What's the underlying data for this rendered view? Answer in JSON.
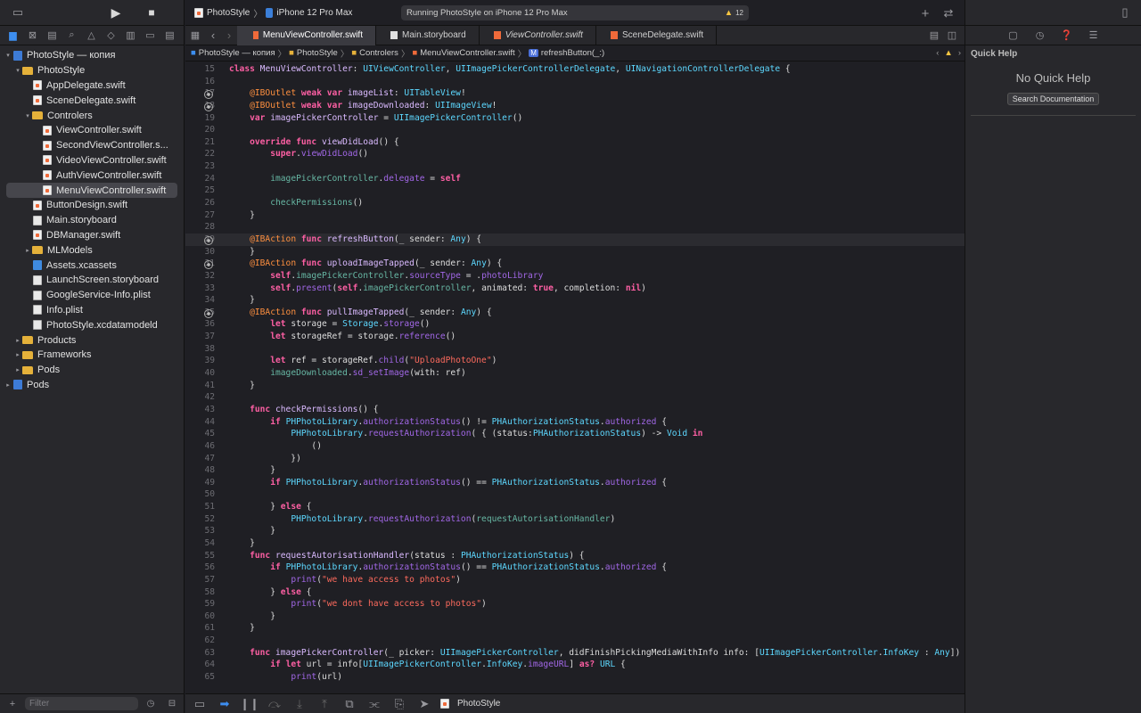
{
  "toolbar": {
    "scheme": "PhotoStyle",
    "device": "iPhone 12 Pro Max",
    "status": "Running PhotoStyle on iPhone 12 Pro Max",
    "warnings": "12"
  },
  "navigator": {
    "filter_placeholder": "Filter",
    "rows": [
      {
        "label": "PhotoStyle — копия",
        "indent": 0,
        "disc": "▾",
        "icon": "proj"
      },
      {
        "label": "PhotoStyle",
        "indent": 1,
        "disc": "▾",
        "icon": "fold"
      },
      {
        "label": "AppDelegate.swift",
        "indent": 2,
        "disc": "",
        "icon": "swift"
      },
      {
        "label": "SceneDelegate.swift",
        "indent": 2,
        "disc": "",
        "icon": "swift"
      },
      {
        "label": "Controlers",
        "indent": 2,
        "disc": "▾",
        "icon": "fold"
      },
      {
        "label": "ViewController.swift",
        "indent": 3,
        "disc": "",
        "icon": "swift"
      },
      {
        "label": "SecondViewController.s...",
        "indent": 3,
        "disc": "",
        "icon": "swift"
      },
      {
        "label": "VideoViewController.swift",
        "indent": 3,
        "disc": "",
        "icon": "swift"
      },
      {
        "label": "AuthViewController.swift",
        "indent": 3,
        "disc": "",
        "icon": "swift"
      },
      {
        "label": "MenuViewController.swift",
        "indent": 3,
        "disc": "",
        "icon": "swift",
        "selected": true
      },
      {
        "label": "ButtonDesign.swift",
        "indent": 2,
        "disc": "",
        "icon": "swift"
      },
      {
        "label": "Main.storyboard",
        "indent": 2,
        "disc": "",
        "icon": "sb"
      },
      {
        "label": "DBManager.swift",
        "indent": 2,
        "disc": "",
        "icon": "swift"
      },
      {
        "label": "MLModels",
        "indent": 2,
        "disc": "▸",
        "icon": "fold"
      },
      {
        "label": "Assets.xcassets",
        "indent": 2,
        "disc": "",
        "icon": "assets"
      },
      {
        "label": "LaunchScreen.storyboard",
        "indent": 2,
        "disc": "",
        "icon": "sb"
      },
      {
        "label": "GoogleService-Info.plist",
        "indent": 2,
        "disc": "",
        "icon": "plist"
      },
      {
        "label": "Info.plist",
        "indent": 2,
        "disc": "",
        "icon": "plist"
      },
      {
        "label": "PhotoStyle.xcdatamodeld",
        "indent": 2,
        "disc": "",
        "icon": "data"
      },
      {
        "label": "Products",
        "indent": 1,
        "disc": "▸",
        "icon": "fold"
      },
      {
        "label": "Frameworks",
        "indent": 1,
        "disc": "▸",
        "icon": "fold"
      },
      {
        "label": "Pods",
        "indent": 1,
        "disc": "▸",
        "icon": "fold"
      },
      {
        "label": "Pods",
        "indent": 0,
        "disc": "▸",
        "icon": "proj"
      }
    ]
  },
  "tabs": [
    {
      "label": "MenuViewController.swift",
      "active": true
    },
    {
      "label": "Main.storyboard",
      "active": false
    },
    {
      "label": "ViewController.swift",
      "active": false
    },
    {
      "label": "SceneDelegate.swift",
      "active": false
    }
  ],
  "jumpbar": {
    "p1": "PhotoStyle — копия",
    "p2": "PhotoStyle",
    "p3": "Controlers",
    "p4": "MenuViewController.swift",
    "p5": "refreshButton(_:)"
  },
  "inspector": {
    "title": "Quick Help",
    "empty": "No Quick Help",
    "search_button": "Search Documentation"
  },
  "bottombar": {
    "scheme": "PhotoStyle"
  },
  "code": [
    {
      "n": 15,
      "t": "<k>class</k> <y>MenuViewController</y>: <t>UIViewController</t>, <t>UIImagePickerControllerDelegate</t>, <t>UINavigationControllerDelegate</t> {"
    },
    {
      "n": 16,
      "t": ""
    },
    {
      "n": 17,
      "bp": true,
      "t": "    <a>@IBOutlet</a> <k>weak</k> <k>var</k> <y>imageList</y>: <t>UITableView</t>!"
    },
    {
      "n": 18,
      "bp": true,
      "t": "    <a>@IBOutlet</a> <k>weak</k> <k>var</k> <y>imageDownloaded</y>: <t>UIImageView</t>!"
    },
    {
      "n": 19,
      "t": "    <k>var</k> <y>imagePickerController</y> = <t>UIImagePickerController</t>()"
    },
    {
      "n": 20,
      "t": ""
    },
    {
      "n": 21,
      "t": "    <k>override</k> <k>func</k> <y>viewDidLoad</y>() {"
    },
    {
      "n": 22,
      "t": "        <k>super</k>.<f>viewDidLoad</f>()"
    },
    {
      "n": 23,
      "t": ""
    },
    {
      "n": 24,
      "t": "        <p>imagePickerController</p>.<f>delegate</f> = <k>self</k>"
    },
    {
      "n": 25,
      "t": ""
    },
    {
      "n": 26,
      "t": "        <p>checkPermissions</p>()"
    },
    {
      "n": 27,
      "t": "    }"
    },
    {
      "n": 28,
      "t": ""
    },
    {
      "n": 29,
      "bp": true,
      "hl": true,
      "t": "    <a>@IBAction</a> <k>func</k> <y>refreshButton</y>(_ sender: <t>Any</t>) {"
    },
    {
      "n": 30,
      "t": "    }"
    },
    {
      "n": 31,
      "bp": true,
      "t": "    <a>@IBAction</a> <k>func</k> <y>uploadImageTapped</y>(_ sender: <t>Any</t>) {"
    },
    {
      "n": 32,
      "t": "        <k>self</k>.<p>imagePickerController</p>.<f>sourceType</f> = .<f>photoLibrary</f>"
    },
    {
      "n": 33,
      "t": "        <k>self</k>.<f>present</f>(<k>self</k>.<p>imagePickerController</p>, animated: <k>true</k>, completion: <k>nil</k>)"
    },
    {
      "n": 34,
      "t": "    }"
    },
    {
      "n": 35,
      "bp": true,
      "t": "    <a>@IBAction</a> <k>func</k> <y>pullImageTapped</y>(_ sender: <t>Any</t>) {"
    },
    {
      "n": 36,
      "t": "        <k>let</k> storage = <t>Storage</t>.<f>storage</f>()"
    },
    {
      "n": 37,
      "t": "        <k>let</k> storageRef = storage.<f>reference</f>()"
    },
    {
      "n": 38,
      "t": ""
    },
    {
      "n": 39,
      "t": "        <k>let</k> ref = storageRef.<f>child</f>(<s>\"UploadPhotoOne\"</s>)"
    },
    {
      "n": 40,
      "t": "        <p>imageDownloaded</p>.<f>sd_setImage</f>(with: ref)"
    },
    {
      "n": 41,
      "t": "    }"
    },
    {
      "n": 42,
      "t": ""
    },
    {
      "n": 43,
      "t": "    <k>func</k> <y>checkPermissions</y>() {"
    },
    {
      "n": 44,
      "t": "        <k>if</k> <t>PHPhotoLibrary</t>.<f>authorizationStatus</f>() != <t>PHAuthorizationStatus</t>.<f>authorized</f> {"
    },
    {
      "n": 45,
      "t": "            <t>PHPhotoLibrary</t>.<f>requestAuthorization</f>( { (status:<t>PHAuthorizationStatus</t>) -> <t>Void</t> <k>in</k>"
    },
    {
      "n": 46,
      "t": "                ()"
    },
    {
      "n": 47,
      "t": "            })"
    },
    {
      "n": 48,
      "t": "        }"
    },
    {
      "n": 49,
      "t": "        <k>if</k> <t>PHPhotoLibrary</t>.<f>authorizationStatus</f>() == <t>PHAuthorizationStatus</t>.<f>authorized</f> {"
    },
    {
      "n": 50,
      "t": ""
    },
    {
      "n": 51,
      "t": "        } <k>else</k> {"
    },
    {
      "n": 52,
      "t": "            <t>PHPhotoLibrary</t>.<f>requestAuthorization</f>(<p>requestAutorisationHandler</p>)"
    },
    {
      "n": 53,
      "t": "        }"
    },
    {
      "n": 54,
      "t": "    }"
    },
    {
      "n": 55,
      "t": "    <k>func</k> <y>requestAutorisationHandler</y>(status : <t>PHAuthorizationStatus</t>) {"
    },
    {
      "n": 56,
      "t": "        <k>if</k> <t>PHPhotoLibrary</t>.<f>authorizationStatus</f>() == <t>PHAuthorizationStatus</t>.<f>authorized</f> {"
    },
    {
      "n": 57,
      "t": "            <f>print</f>(<s>\"we have access to photos\"</s>)"
    },
    {
      "n": 58,
      "t": "        } <k>else</k> {"
    },
    {
      "n": 59,
      "t": "            <f>print</f>(<s>\"we dont have access to photos\"</s>)"
    },
    {
      "n": 60,
      "t": "        }"
    },
    {
      "n": 61,
      "t": "    }"
    },
    {
      "n": 62,
      "t": ""
    },
    {
      "n": 63,
      "t": "    <k>func</k> <y>imagePickerController</y>(_ picker: <t>UIImagePickerController</t>, didFinishPickingMediaWithInfo info: [<t>UIImagePickerController</t>.<t>InfoKey</t> : <t>Any</t>]) {"
    },
    {
      "n": 64,
      "t": "        <k>if</k> <k>let</k> url = info[<t>UIImagePickerController</t>.<t>InfoKey</t>.<f>imageURL</f>] <k>as?</k> <t>URL</t> {"
    },
    {
      "n": 65,
      "t": "            <f>print</f>(url)"
    }
  ]
}
